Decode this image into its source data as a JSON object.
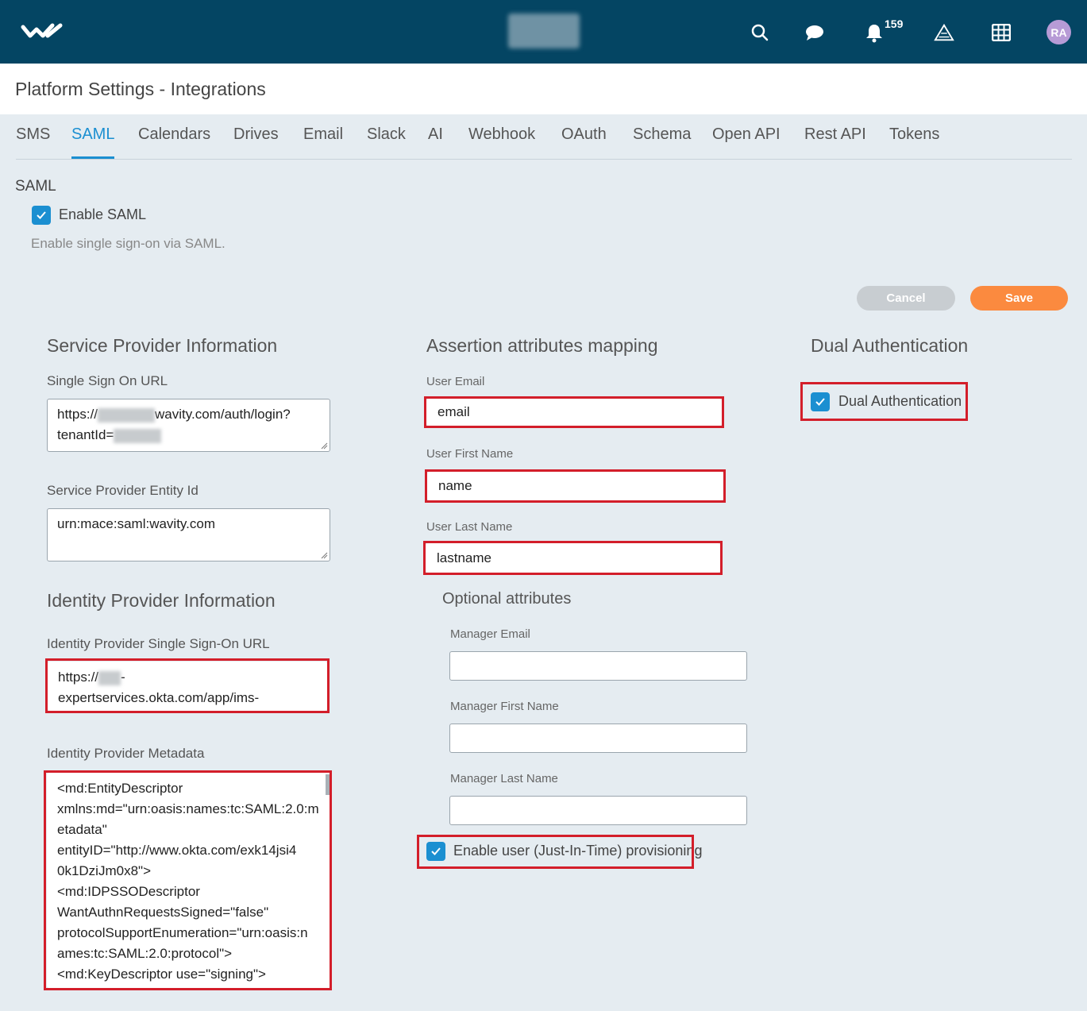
{
  "header": {
    "notification_count": "159",
    "avatar_initials": "RA",
    "icons": [
      "search-icon",
      "chat-icon",
      "bell-icon",
      "chart-icon",
      "grid-icon"
    ]
  },
  "page": {
    "title": "Platform Settings - Integrations"
  },
  "tabs": [
    {
      "label": "SMS"
    },
    {
      "label": "SAML"
    },
    {
      "label": "Calendars"
    },
    {
      "label": "Drives"
    },
    {
      "label": "Email"
    },
    {
      "label": "Slack"
    },
    {
      "label": "AI"
    },
    {
      "label": "Webhook"
    },
    {
      "label": "OAuth"
    },
    {
      "label": "Schema"
    },
    {
      "label": "Open API"
    },
    {
      "label": "Rest API"
    },
    {
      "label": "Tokens"
    }
  ],
  "active_tab": "SAML",
  "saml": {
    "section_title": "SAML",
    "enable_label": "Enable SAML",
    "enable_checked": true,
    "helper": "Enable single sign-on via SAML."
  },
  "actions": {
    "cancel": "Cancel",
    "save": "Save"
  },
  "service_provider": {
    "heading": "Service Provider Information",
    "sso_url_label": "Single Sign On URL",
    "sso_url_prefix": "https://",
    "sso_url_middle": "wavity.com/auth/login?",
    "sso_url_line2": "tenantId=",
    "entity_id_label": "Service Provider Entity Id",
    "entity_id_value": "urn:mace:saml:wavity.com"
  },
  "identity_provider": {
    "heading": "Identity Provider Information",
    "sso_url_label": "Identity Provider Single Sign-On URL",
    "sso_url_line1_prefix": "https://",
    "sso_url_line1_suffix": "-",
    "sso_url_line2": "expertservices.okta.com/app/ims-",
    "metadata_label": "Identity Provider Metadata",
    "metadata_lines": [
      "<md:EntityDescriptor",
      "xmlns:md=\"urn:oasis:names:tc:SAML:2.0:m",
      "etadata\"",
      "entityID=\"http://www.okta.com/exk14jsi4",
      "0k1DziJm0x8\">",
      "<md:IDPSSODescriptor",
      "WantAuthnRequestsSigned=\"false\"",
      "protocolSupportEnumeration=\"urn:oasis:n",
      "ames:tc:SAML:2.0:protocol\">",
      "<md:KeyDescriptor use=\"signing\">"
    ]
  },
  "assertion": {
    "heading": "Assertion attributes mapping",
    "email_label": "User Email",
    "email_value": "email",
    "first_label": "User First Name",
    "first_value": "name",
    "last_label": "User Last Name",
    "last_value": "lastname",
    "optional_heading": "Optional attributes",
    "mgr_email_label": "Manager Email",
    "mgr_email_value": "",
    "mgr_first_label": "Manager First Name",
    "mgr_first_value": "",
    "mgr_last_label": "Manager Last Name",
    "mgr_last_value": "",
    "jit_label": "Enable user (Just-In-Time) provisioning",
    "jit_checked": true
  },
  "dual_auth": {
    "heading": "Dual Authentication",
    "label": "Dual Authentication",
    "checked": true
  },
  "colors": {
    "header_bg": "#044563",
    "accent": "#1b8fd1",
    "save": "#fb8a3f",
    "cancel": "#c8cdd1",
    "highlight": "#d31e2a"
  }
}
